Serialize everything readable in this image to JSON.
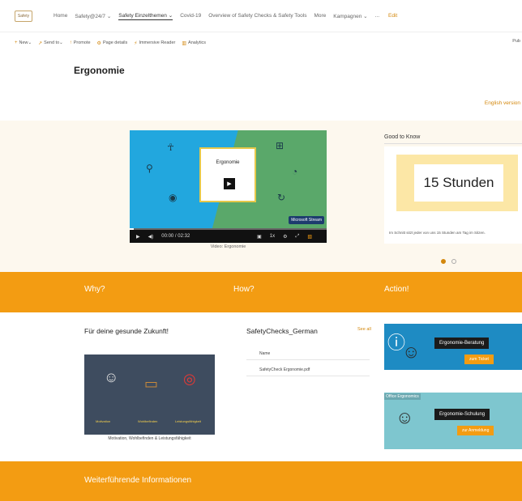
{
  "topnav": {
    "logo_text": "Safety",
    "items": [
      "Home",
      "Safety@24/7",
      "Safety Einzelthemen",
      "Covid-19",
      "Overview of Safety Checks & Safety Tools",
      "More",
      "Kampagnen",
      "..."
    ],
    "active_index": 2,
    "edit_label": "Edit"
  },
  "cmdbar": {
    "items": [
      {
        "icon": "+",
        "label": "New"
      },
      {
        "icon": "↗",
        "label": "Send to"
      },
      {
        "icon": "↑",
        "label": "Promote"
      },
      {
        "icon": "⚙",
        "label": "Page details"
      },
      {
        "icon": "⚡",
        "label": "Immersive Reader"
      },
      {
        "icon": "▥",
        "label": "Analytics"
      }
    ],
    "right_label": "Pub"
  },
  "page": {
    "title": "Ergonomie",
    "lang_link": "English version"
  },
  "video": {
    "card_title": "Ergonomie",
    "badge": "Microsoft Stream",
    "time": "00:00 / 02:32",
    "caption": "Video: Ergonomie",
    "progress": 0.02
  },
  "good_to_know": {
    "title": "Good to Know",
    "headline": "15 Stunden",
    "text": "Im Schnitt sitzt jeder von uns 15 Stunden am Tag im Sitzen.",
    "active_slide": 0,
    "slides": 2
  },
  "bands": {
    "why": "Why?",
    "how": "How?",
    "action": "Action!",
    "more_info": "Weiterführende Informationen"
  },
  "why": {
    "title": "Für deine gesunde Zukunft!",
    "labels": [
      "Motivation",
      "Wohlbefinden",
      "Leistungsfähigkeit"
    ],
    "caption": "Motivation, Wohlbefinden & Leistungsfähigkeit"
  },
  "how": {
    "title": "SafetyChecks_German",
    "see_all": "See all",
    "rows": [
      "Name",
      "SafetyCheck Ergonomie.pdf"
    ]
  },
  "action": {
    "tile1_title": "Ergonomie-Beratung",
    "tile1_button": "zum Ticket",
    "tile2_tag": "Office Ergonomics",
    "tile2_title": "Ergonomie-Schulung",
    "tile2_button": "zur Anmeldung"
  },
  "colors": {
    "accent": "#f39c12",
    "link": "#d3870c",
    "hero_bg": "#fdf8ee"
  }
}
